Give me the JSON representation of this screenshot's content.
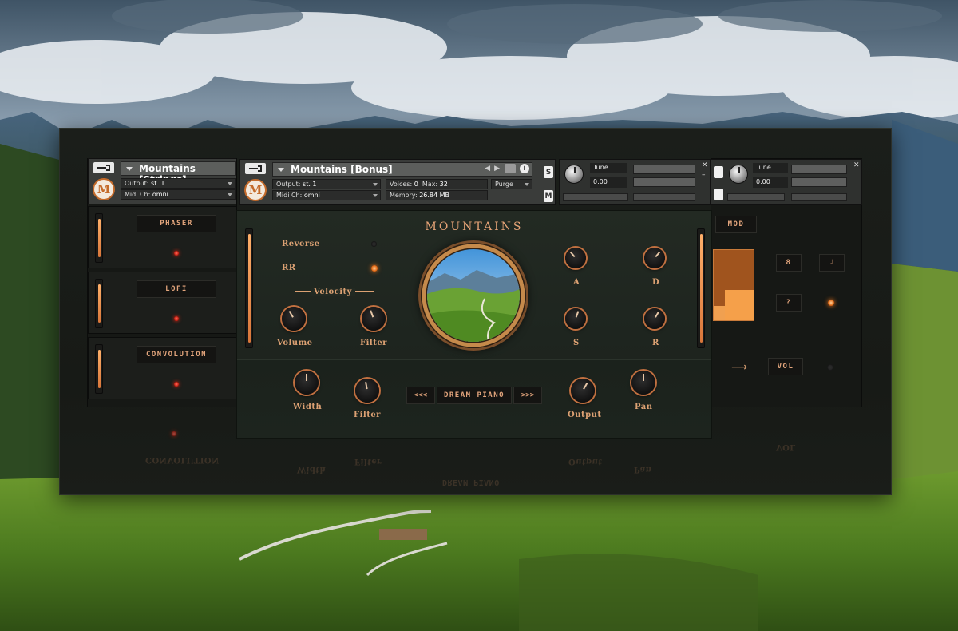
{
  "colors": {
    "accent": "#dca173",
    "led": "#e26a15",
    "panel": "#1b1e1a"
  },
  "left_instrument": {
    "name": "Mountains [Strings]",
    "output_label": "Output:",
    "output_value": "st. 1",
    "midi_label": "Midi Ch:",
    "midi_value": "omni",
    "effects": [
      {
        "label": "PHASER"
      },
      {
        "label": "LOFI"
      },
      {
        "label": "CONVOLUTION"
      }
    ]
  },
  "main_instrument": {
    "name": "Mountains [Bonus]",
    "output_label": "Output:",
    "output_value": "st. 1",
    "midi_label": "Midi Ch:",
    "midi_value": "omni",
    "voices_label": "Voices:",
    "voices_value": "0",
    "max_label": "Max:",
    "max_value": "32",
    "memory_label": "Memory:",
    "memory_value": "26.84 MB",
    "purge_label": "Purge",
    "tune_label": "Tune",
    "tune_value": "0.00",
    "s_label": "S",
    "m_label": "M"
  },
  "right_instrument": {
    "tune_label": "Tune",
    "tune_value": "0.00",
    "mod_label": "MOD",
    "btn_8": "8",
    "btn_q": "?",
    "vol_label": "VOL"
  },
  "ui": {
    "title": "MOUNTAINS",
    "reverse_label": "Reverse",
    "rr_label": "RR",
    "velocity_label": "Velocity",
    "volume_label": "Volume",
    "filter_label": "Filter",
    "adsr": {
      "a": "A",
      "d": "D",
      "s": "S",
      "r": "R"
    },
    "width_label": "Width",
    "filter2_label": "Filter",
    "preset_prev": "<<<",
    "preset_name": "DREAM PIANO",
    "preset_next": ">>>",
    "output_label": "Output",
    "pan_label": "Pan"
  }
}
